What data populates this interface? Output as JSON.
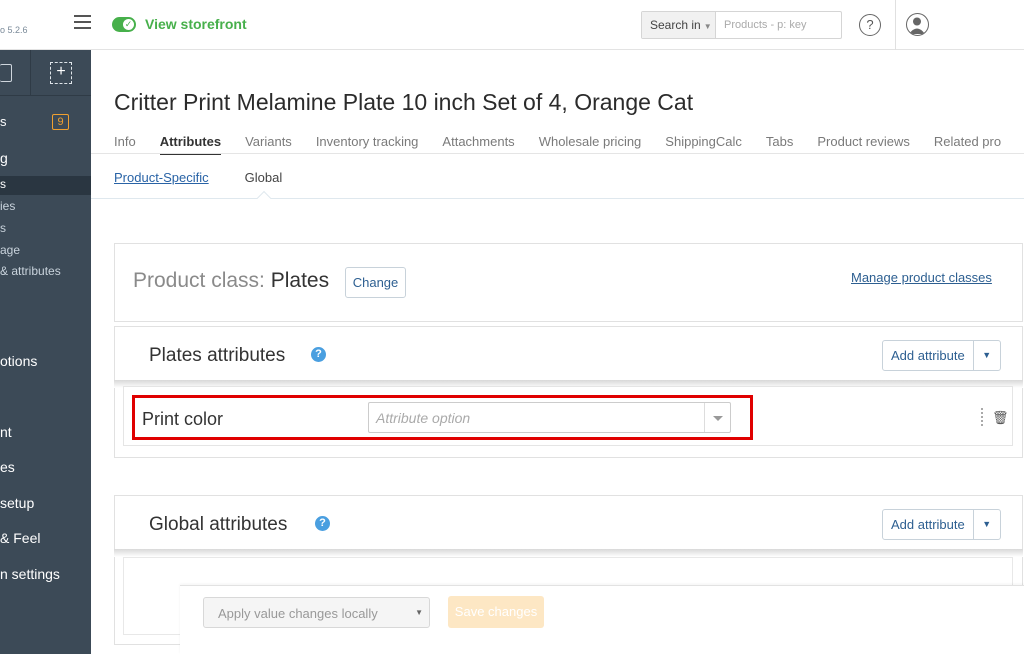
{
  "topbar": {
    "version": "o 5.2.6",
    "storefront_label": "View storefront",
    "search_in_label": "Search in",
    "search_placeholder": "Products - p: key",
    "help_label": "?"
  },
  "sidebar": {
    "badge_count": "9",
    "items": [
      "s",
      "g",
      "s",
      "ies",
      "s",
      "age",
      "& attributes",
      "otions",
      "nt",
      "es",
      "setup",
      "& Feel",
      "n settings"
    ]
  },
  "product": {
    "title": "Critter Print Melamine Plate 10 inch Set of 4, Orange Cat"
  },
  "tabs": [
    "Info",
    "Attributes",
    "Variants",
    "Inventory tracking",
    "Attachments",
    "Wholesale pricing",
    "ShippingCalc",
    "Tabs",
    "Product reviews",
    "Related pro"
  ],
  "subtabs": [
    "Product-Specific",
    "Global"
  ],
  "product_class": {
    "label": "Product class:",
    "value": "Plates",
    "change_label": "Change",
    "manage_link": "Manage product classes"
  },
  "plates_section": {
    "title": "Plates attributes",
    "add_label": "Add attribute",
    "attribute_name": "Print color",
    "attribute_placeholder": "Attribute option"
  },
  "global_section": {
    "title": "Global attributes",
    "add_label": "Add attribute"
  },
  "bottom": {
    "apply_label": "Apply value changes locally",
    "save_label": "Save changes"
  },
  "colors": {
    "accent_green": "#47b04b",
    "sidebar_bg": "#3c4a57",
    "link_blue": "#2d5f91",
    "highlight_red": "#e00000"
  }
}
